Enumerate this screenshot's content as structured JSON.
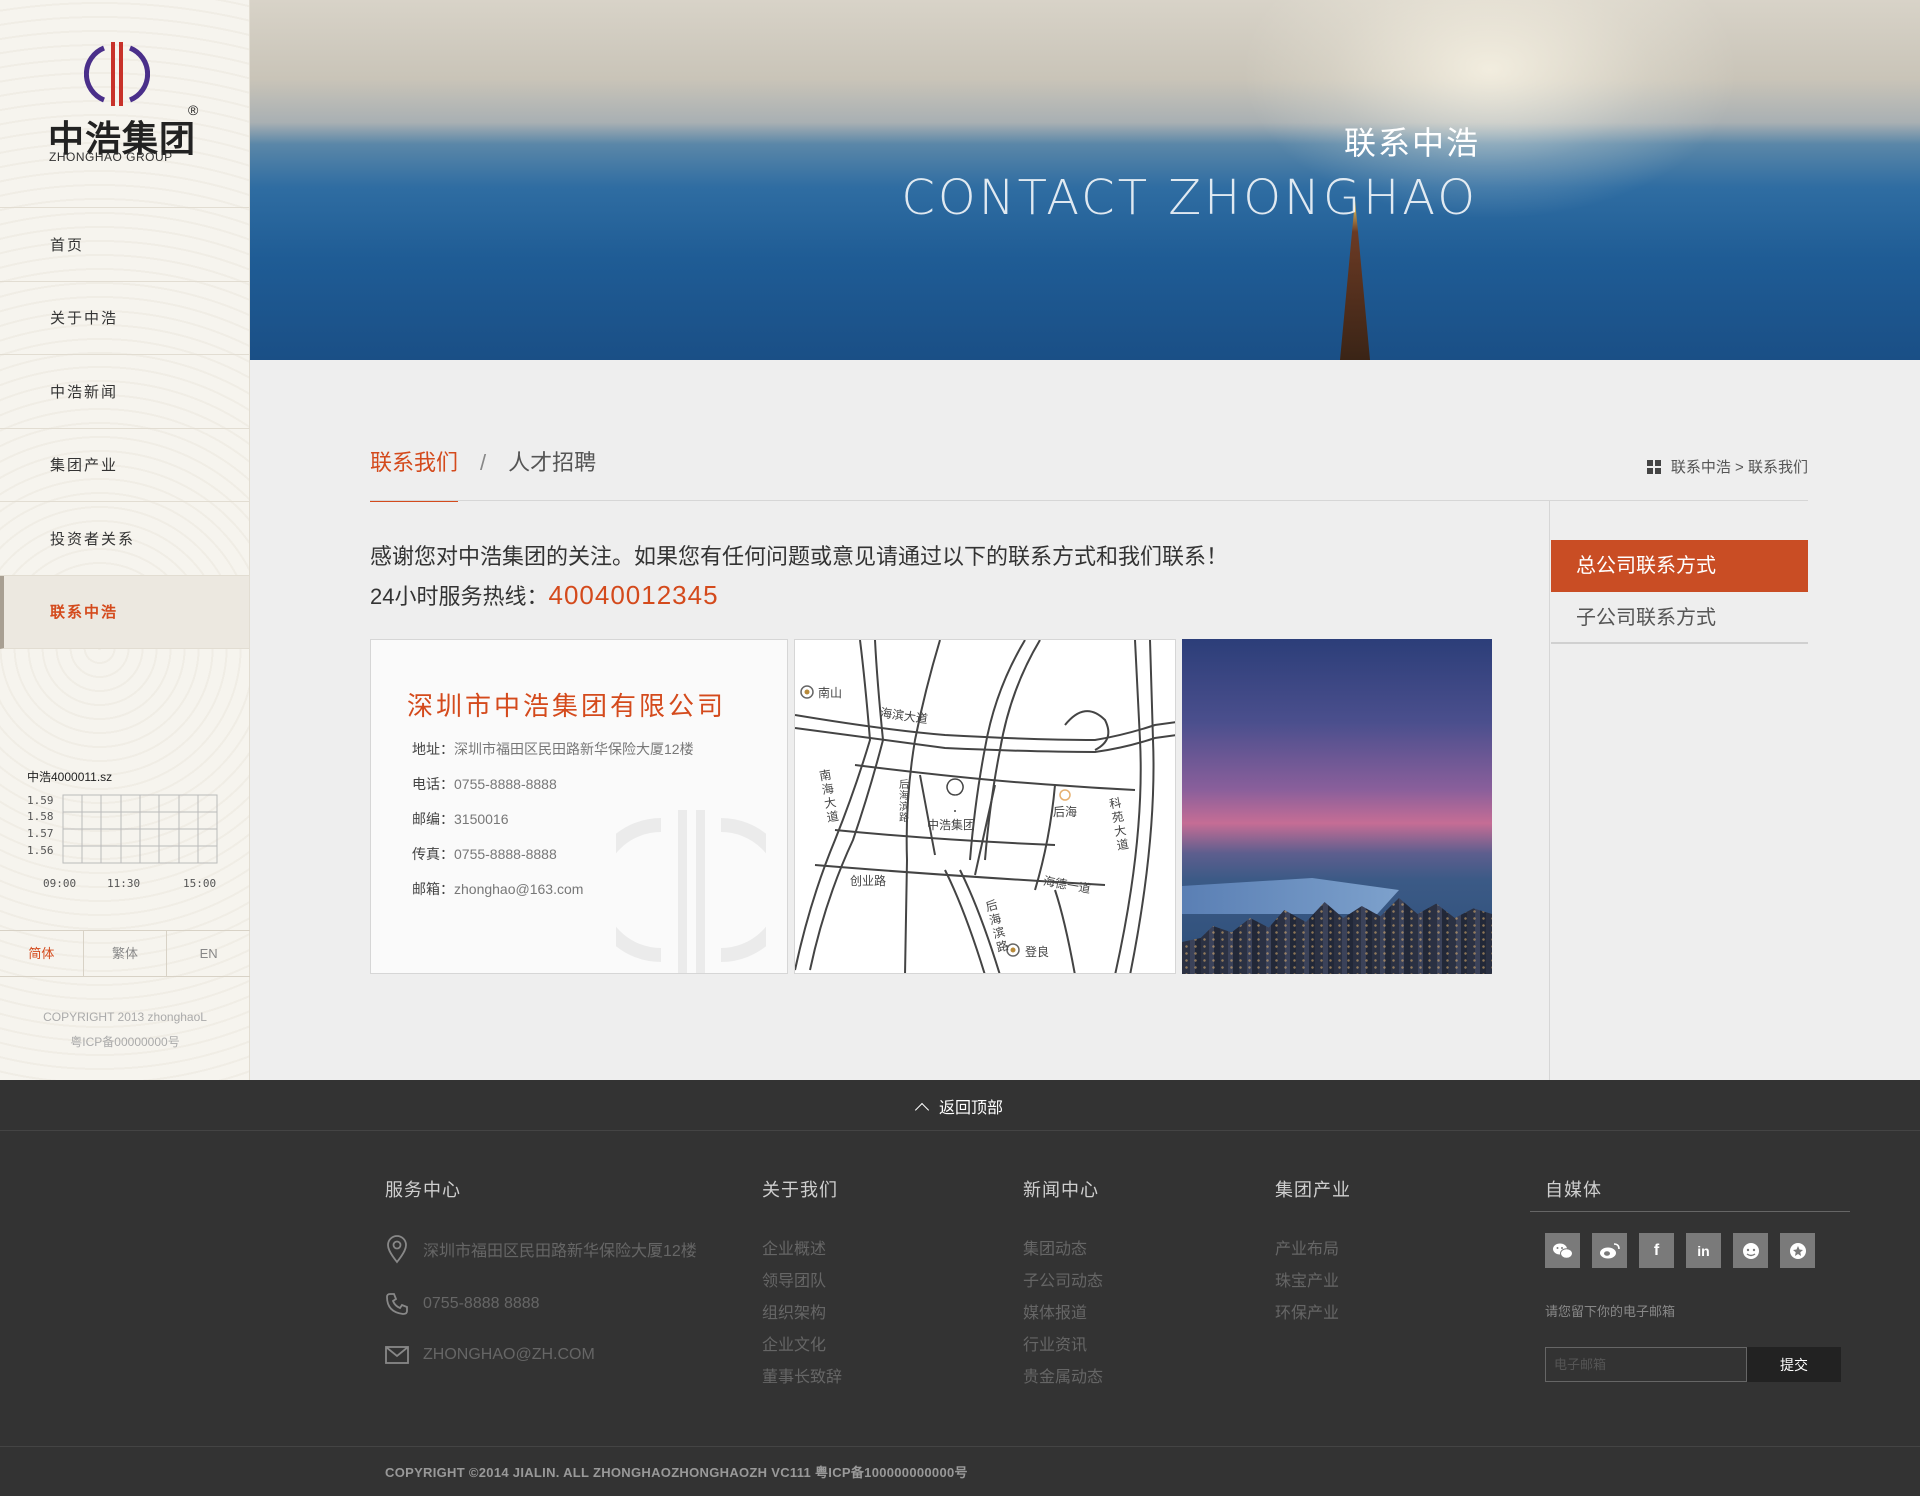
{
  "sidebar": {
    "logo_cn": "中浩集团",
    "logo_reg": "®",
    "logo_en": "ZHONGHAO GROUP",
    "nav": [
      {
        "label": "首页"
      },
      {
        "label": "关于中浩"
      },
      {
        "label": "中浩新闻"
      },
      {
        "label": "集团产业"
      },
      {
        "label": "投资者关系"
      },
      {
        "label": "联系中浩",
        "active": true
      }
    ],
    "stock": {
      "title": "中浩4000011.sz",
      "y_ticks": [
        "1.59",
        "1.58",
        "1.57",
        "1.56"
      ],
      "x_ticks": [
        "09:00",
        "11:30",
        "15:00"
      ]
    },
    "languages": [
      {
        "label": "简体",
        "active": true
      },
      {
        "label": "繁体"
      },
      {
        "label": "EN"
      }
    ],
    "copyright_line1": "COPYRIGHT 2013 zhonghaoL",
    "copyright_line2": "粤ICP备00000000号"
  },
  "banner": {
    "title_cn": "联系中浩",
    "title_en": "CONTACT ZHONGHAO"
  },
  "tabs": [
    {
      "label": "联系我们",
      "active": true
    },
    {
      "label": "人才招聘"
    }
  ],
  "tab_separator": "/",
  "breadcrumb": "联系中浩 > 联系我们",
  "intro": {
    "text": "感谢您对中浩集团的关注。如果您有任何问题或意见请通过以下的联系方式和我们联系！",
    "hotline_label": "24小时服务热线：",
    "hotline_number": "40040012345"
  },
  "card": {
    "company": "深圳市中浩集团有限公司",
    "rows": [
      {
        "label": "地址：",
        "value": "深圳市福田区民田路新华保险大厦12楼"
      },
      {
        "label": "电话：",
        "value": "0755-8888-8888"
      },
      {
        "label": "邮编：",
        "value": "3150016"
      },
      {
        "label": "传真：",
        "value": "0755-8888-8888"
      },
      {
        "label": "邮箱：",
        "value": "zhonghao@163.com"
      }
    ]
  },
  "map": {
    "labels": {
      "nanshan": "南山",
      "haibin": "海滨大道",
      "nanhai": "南海大道",
      "houhaibin": "后海滨路",
      "center": "中浩集团",
      "houhai": "后海",
      "keyuan": "科苑大道",
      "chuangye": "创业路",
      "haide": "海德一道",
      "houhaibin2": "后海滨路",
      "dengliang": "登良"
    }
  },
  "sub_nav": [
    {
      "label": "总公司联系方式",
      "active": true
    },
    {
      "label": "子公司联系方式"
    }
  ],
  "footer": {
    "back_to_top": "返回顶部",
    "service": {
      "title": "服务中心",
      "address": "深圳市福田区民田路新华保险大厦12楼",
      "phone": "0755-8888 8888",
      "email": "ZHONGHAO@ZH.COM"
    },
    "about": {
      "title": "关于我们",
      "links": [
        "企业概述",
        "领导团队",
        "组织架构",
        "企业文化",
        "董事长致辞"
      ]
    },
    "news": {
      "title": "新闻中心",
      "links": [
        "集团动态",
        "子公司动态",
        "媒体报道",
        "行业资讯",
        "贵金属动态"
      ]
    },
    "industry": {
      "title": "集团产业",
      "links": [
        "产业布局",
        "珠宝产业",
        "环保产业"
      ]
    },
    "media": {
      "title": "自媒体",
      "socials": [
        "wechat-icon",
        "weibo-icon",
        "facebook-icon",
        "linkedin-icon",
        "douban-icon",
        "qzone-icon"
      ],
      "mail_hint": "请您留下你的电子邮箱",
      "mail_placeholder": "电子邮箱",
      "submit": "提交"
    },
    "copyright": "COPYRIGHT ©2014 JIALIN. ALL ZHONGHAOZHONGHAOZH VC111 粤ICP备100000000000号"
  }
}
